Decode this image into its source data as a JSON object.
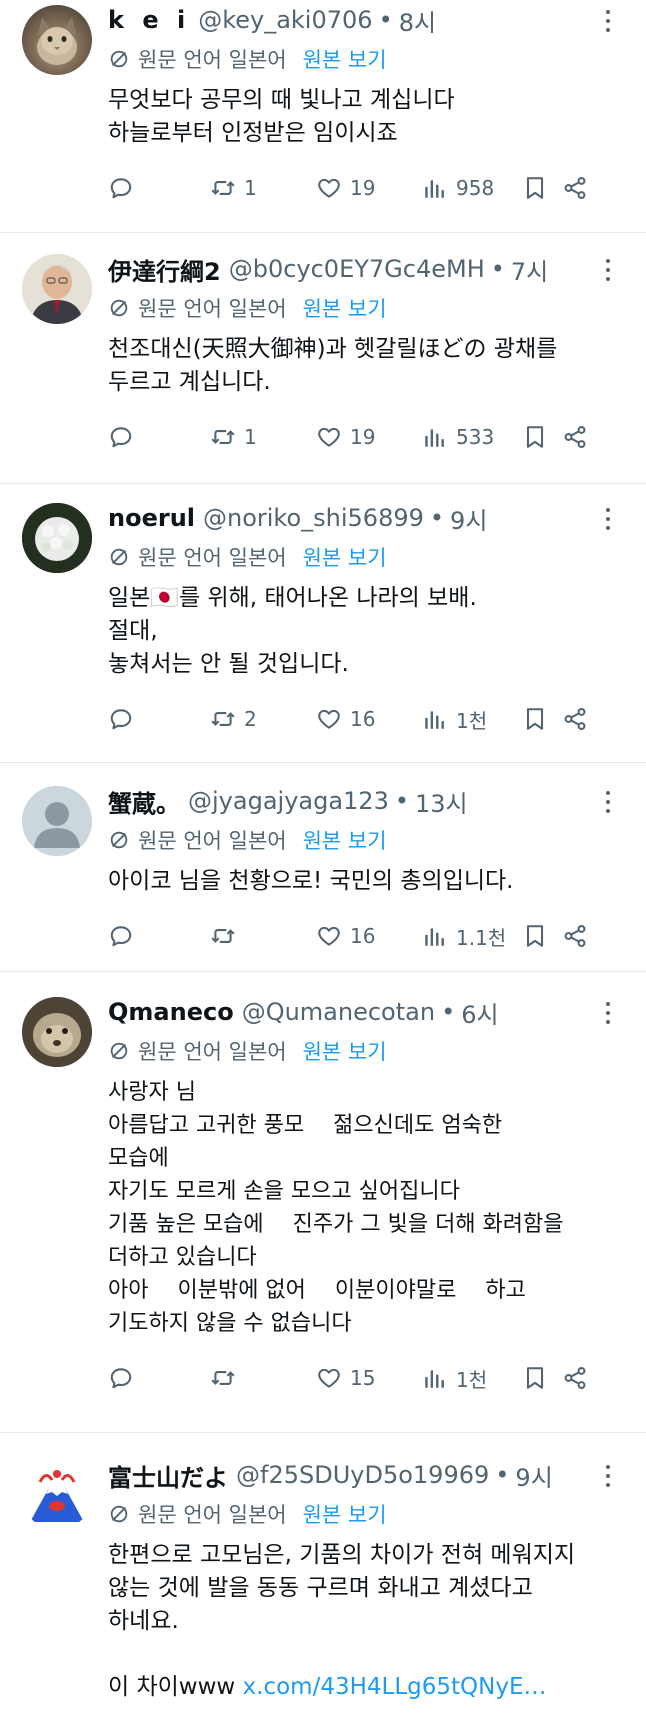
{
  "translation": {
    "label": "원문 언어 일본어",
    "show_original": "원본 보기"
  },
  "posts": [
    {
      "name": "k e i",
      "handle": "@key_aki0706",
      "time": "8시",
      "text": "무엇보다 공무의 때 빛나고 계십니다\n하늘로부터 인정받은 임이시죠",
      "retweets": "1",
      "likes": "19",
      "views": "958"
    },
    {
      "name": "伊達行綱2",
      "handle": "@b0cyc0EY7Gc4eMH",
      "time": "7시",
      "text": "천조대신(天照大御神)과 헷갈릴ほどの 광채를\n두르고 계십니다.",
      "retweets": "1",
      "likes": "19",
      "views": "533"
    },
    {
      "name": "noerul",
      "handle": "@noriko_shi56899",
      "time": "9시",
      "text_before_flag": "일본",
      "flag": "🇯🇵",
      "text": "를 위해, 태어나온 나라의 보배.\n절대,\n놓쳐서는 안 될 것입니다.",
      "retweets": "2",
      "likes": "16",
      "views": "1천"
    },
    {
      "name": "蟹蔵。",
      "handle": "@jyagajyaga123",
      "time": "13시",
      "text": "아이코 님을 천황으로! 국민의 총의입니다.",
      "retweets": "",
      "likes": "16",
      "views": "1.1천"
    },
    {
      "name": "Qmaneco",
      "handle": "@Qumanecotan",
      "time": "6시",
      "text": "사랑자 님\n아름답고 고귀한 풍모　 젊으신데도 엄숙한\n모습에\n자기도 모르게 손을 모으고 싶어집니다\n기품 높은 모습에　 진주가 그 빛을 더해 화려함을\n더하고 있습니다\n아아　 이분밖에 없어　 이분이야말로　 하고\n기도하지 않을 수 없습니다",
      "retweets": "",
      "likes": "15",
      "views": "1천"
    },
    {
      "name": "富士山だよ",
      "handle": "@f25SDUyD5o19969",
      "time": "9시",
      "text": "한편으로 고모님은, 기품의 차이가 전혀 메워지지\n않는 것에 발을 동동 구르며 화내고 계셨다고\n하네요.\n\n이 차이www ",
      "link": "x.com/43H4LLg65tQNyE…"
    }
  ],
  "colors": {
    "text": "#0f1419",
    "muted": "#536471",
    "accent": "#1d9bf0",
    "divider": "#e7e9ea"
  },
  "icons": [
    "more-icon",
    "translate-icon",
    "reply-icon",
    "retweet-icon",
    "like-icon",
    "views-icon",
    "bookmark-icon",
    "share-icon"
  ]
}
